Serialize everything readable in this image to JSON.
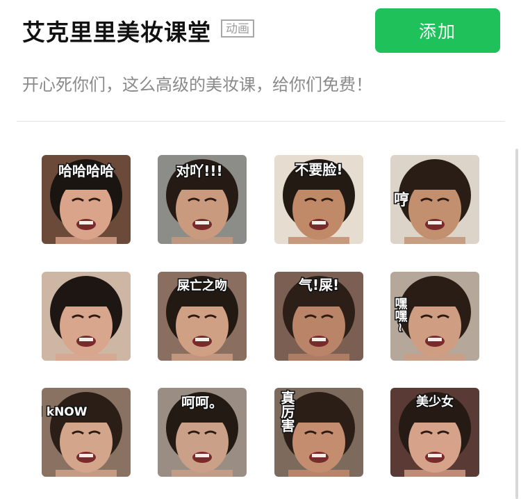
{
  "header": {
    "title": "艾克里里美妆课堂",
    "badge": "动画",
    "add_label": "添加",
    "description": "开心死你们，这么高级的美妆课，给你们免费！"
  },
  "colors": {
    "add_button": "#1fc15a",
    "divider": "#e3e3e3",
    "muted_text": "#8a8a8a"
  },
  "stickers": [
    {
      "caption": "哈哈哈哈",
      "bg": "#6b4a3a",
      "skin": "#d9a48a",
      "hair": "#1b1512"
    },
    {
      "caption": "对吖!!!",
      "bg": "#8c8c88",
      "skin": "#c99a7d",
      "hair": "#251a14"
    },
    {
      "caption": "不要脸!",
      "bg": "#e6dccf",
      "skin": "#c08a68",
      "hair": "#231a14"
    },
    {
      "caption": "哼",
      "bg": "#dcd4c8",
      "skin": "#c2906f",
      "hair": "#2a1d15"
    },
    {
      "caption": "",
      "bg": "#cdb6a3",
      "skin": "#d8a58d",
      "hair": "#1e1612"
    },
    {
      "caption": "屎亡之吻",
      "bg": "#8a6f60",
      "skin": "#cfa083",
      "hair": "#231913"
    },
    {
      "caption": "气!屎!",
      "bg": "#7a5f52",
      "skin": "#b98468",
      "hair": "#2b1f18"
    },
    {
      "caption": "嘿嘿~",
      "bg": "#b5a79a",
      "skin": "#cf9e82",
      "hair": "#2a1d15"
    },
    {
      "caption": "I kNOW",
      "bg": "#8a7262",
      "skin": "#d3a68c",
      "hair": "#2a1e17"
    },
    {
      "caption": "呵呵。",
      "bg": "#9a8e84",
      "skin": "#caa088",
      "hair": "#231a14"
    },
    {
      "caption": "真厉害",
      "bg": "#7c6a5d",
      "skin": "#c48d70",
      "hair": "#2a1e16"
    },
    {
      "caption": "美少女",
      "bg": "#5a3a35",
      "skin": "#d6a38a",
      "hair": "#261a15"
    }
  ]
}
